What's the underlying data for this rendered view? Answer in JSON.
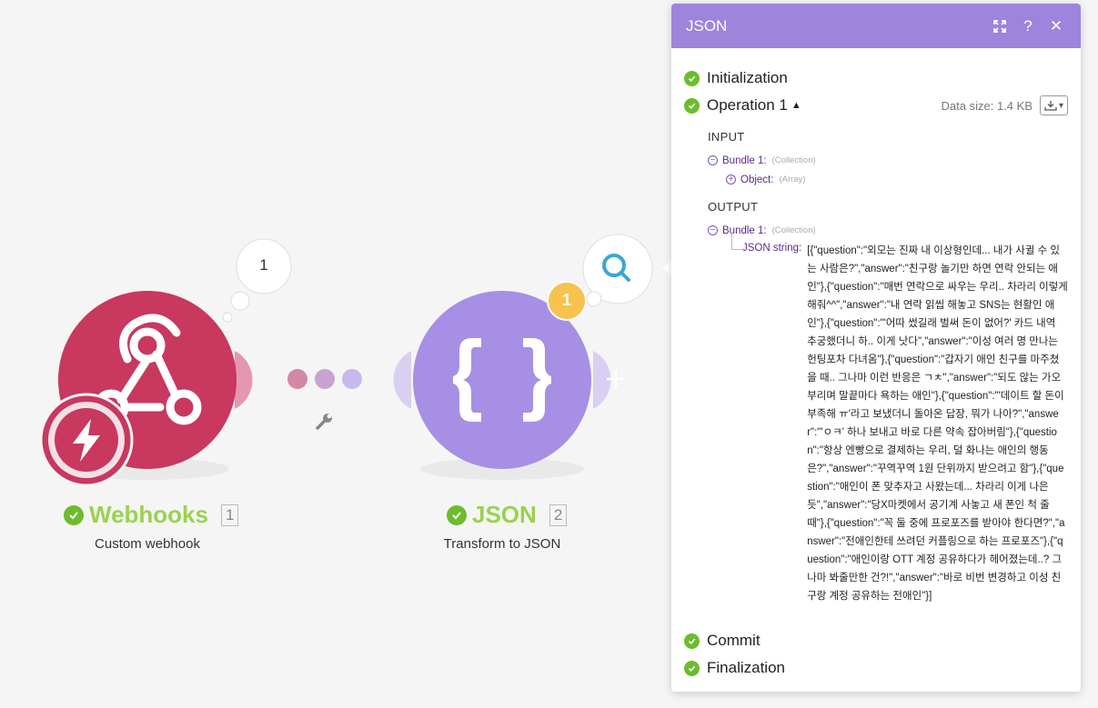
{
  "canvas": {
    "webhook_module": {
      "name": "Webhooks",
      "number": "1",
      "subtitle": "Custom webhook",
      "bubble_count": "1",
      "color": "#c8385f"
    },
    "json_module": {
      "name": "JSON",
      "number": "2",
      "subtitle": "Transform to JSON",
      "badge_count": "1",
      "color": "#a78fe6"
    },
    "label_color": "#9bd24e"
  },
  "panel": {
    "title": "JSON",
    "header_color": "#9e84dc",
    "buttons": [
      "expand-icon",
      "help-icon",
      "close-icon"
    ],
    "help_label": "?",
    "close_label": "✕",
    "operations": {
      "initialization": "Initialization",
      "operation_label": "Operation 1",
      "data_size": "Data size: 1.4 KB",
      "commit": "Commit",
      "finalization": "Finalization"
    },
    "input": {
      "title": "INPUT",
      "bundle_label": "Bundle 1:",
      "bundle_type": "(Collection)",
      "object_label": "Object:",
      "object_type": "(Array)"
    },
    "output": {
      "title": "OUTPUT",
      "bundle_label": "Bundle 1:",
      "bundle_type": "(Collection)",
      "json_key": "JSON string:",
      "json_value": "[{\"question\":\"외모는 진짜 내 이상형인데... 내가 사귈 수 있는 사람은?\",\"answer\":\"친구랑 놀기만 하면 연락 안되는 애인\"},{\"question\":\"매번 연락으로 싸우는 우리.. 차라리 이렇게 해줘^^\",\"answer\":\"내 연락 읽씹 해놓고 SNS는 현활인 애인\"},{\"question\":\"'어따 썼길래 벌써 돈이 없어?' 카드 내역 추궁했더니 하.. 이게 낫다\",\"answer\":\"이성 여러 명 만나는 헌팅포차 다녀옴\"},{\"question\":\"갑자기 애인 친구를 마주쳤을 때.. 그나마 이런 반응은 ㄱㅊ\",\"answer\":\"되도 않는 가오 부리며 말끝마다 욕하는 애인\"},{\"question\":\"'데이트 할 돈이 부족해 ㅠ'라고 보냈더니 돌아온 답장, 뭐가 나아?\",\"answer\":\"'ㅇㅋ' 하나 보내고 바로 다른 약속 잡아버림\"},{\"question\":\"항상 엔빵으로 결제하는 우리, 덜 화나는 애인의 행동은?\",\"answer\":\"꾸역꾸역 1원 단위까지 받으려고 함\"},{\"question\":\"애인이 폰 맞추자고 사왔는데... 차라리 이게 나은 듯\",\"answer\":\"당X마켓에서 공기계 사놓고 새 폰인 척 줄 때\"},{\"question\":\"꼭 둘 중에 프로포즈를 받아야 한다면?\",\"answer\":\"전애인한테 쓰려던 커플링으로 하는 프로포즈\"},{\"question\":\"애인이랑 OTT 계정 공유하다가 헤어졌는데..? 그나마 봐줄만한 건?!\",\"answer\":\"바로 비번 변경하고 이성 친구랑 계정 공유하는 전애인\"}]"
    }
  }
}
